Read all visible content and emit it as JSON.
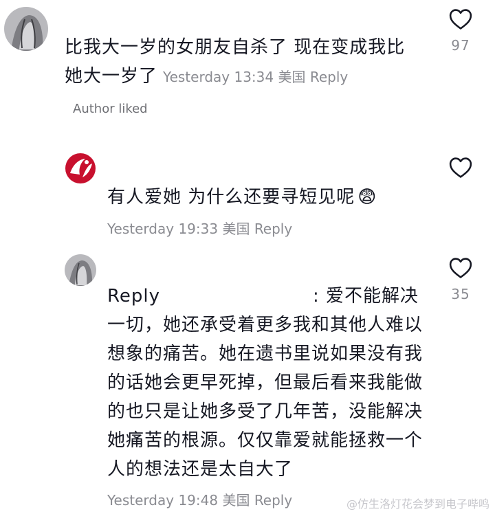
{
  "comments": [
    {
      "text_line1": "比我大一岁的女朋友自杀了 现在变成我比",
      "text_line2": "她大一岁了",
      "time": "Yesterday 13:34",
      "location": "美国",
      "reply_label": "Reply",
      "like_count": "97",
      "author_liked": "Author liked"
    },
    {
      "text": "有人爱她 为什么还要寻短见呢",
      "emoji": "😨",
      "time": "Yesterday 19:33",
      "location": "美国",
      "reply_label": "Reply"
    },
    {
      "reply_prefix": "Reply",
      "lines": [
        ": 爱不能解决",
        "一切，她还承受着更多我和其他人难以",
        "想象的痛苦。她在遗书里说如果没有我",
        "的话她会更早死掉，但最后看来我能做",
        "的也只是让她多受了几年苦，没能解决",
        "她痛苦的根源。仅仅靠爱就能拯救一个",
        "人的想法还是太自大了"
      ],
      "time": "Yesterday 19:48",
      "location": "美国",
      "reply_label": "Reply",
      "like_count": "35"
    }
  ],
  "watermark": "@仿生洛灯花会梦到电子哔鸣"
}
